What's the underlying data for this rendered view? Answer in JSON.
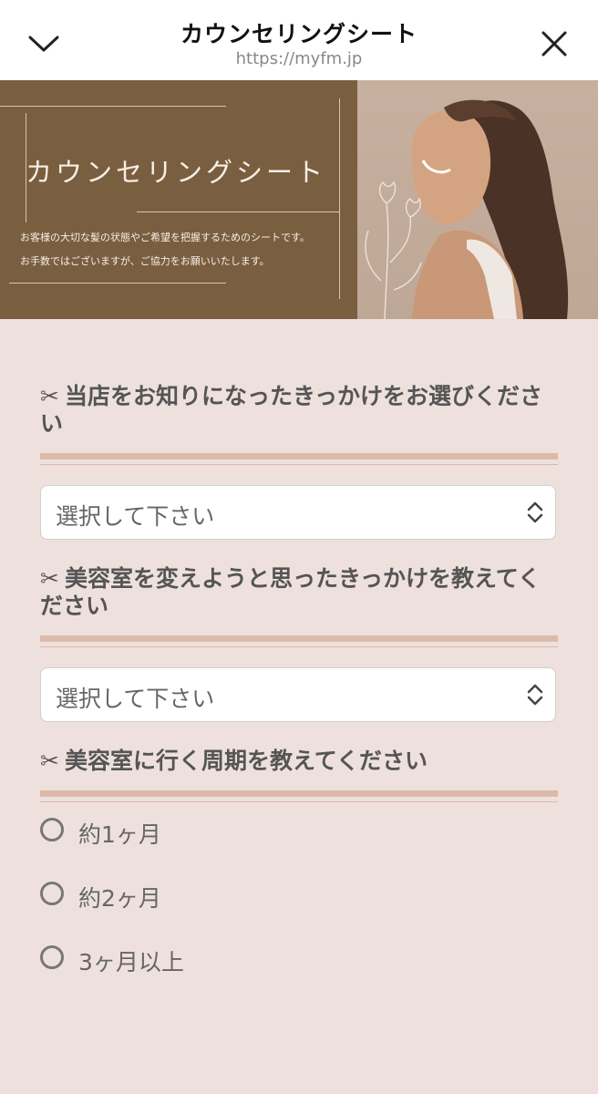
{
  "header": {
    "title": "カウンセリングシート",
    "url": "https://myfm.jp",
    "left_icon": "chevron-down-icon",
    "right_icon": "close-icon"
  },
  "hero": {
    "title": "カウンセリングシート",
    "subtitle_line1": "お客様の大切な髪の状態やご希望を把握するためのシートです。",
    "subtitle_line2": "お手数ではございますが、ご協力をお願いいたします。",
    "colors": {
      "left_panel": "#7a5e40",
      "right_panel": "#c7b09f"
    }
  },
  "questions": [
    {
      "icon": "✂",
      "title": "当店をお知りになったきっかけをお選びください",
      "type": "select",
      "selected": "選択して下さい"
    },
    {
      "icon": "✂",
      "title": "美容室を変えようと思ったきっかけを教えてください",
      "type": "select",
      "selected": "選択して下さい"
    },
    {
      "icon": "✂",
      "title": "美容室に行く周期を教えてください",
      "type": "radio",
      "options": [
        "約1ヶ月",
        "約2ヶ月",
        "3ヶ月以上"
      ]
    }
  ],
  "colors": {
    "background": "#eee1dd",
    "accent_rule": "#dcb9a8",
    "text": "#555555"
  }
}
